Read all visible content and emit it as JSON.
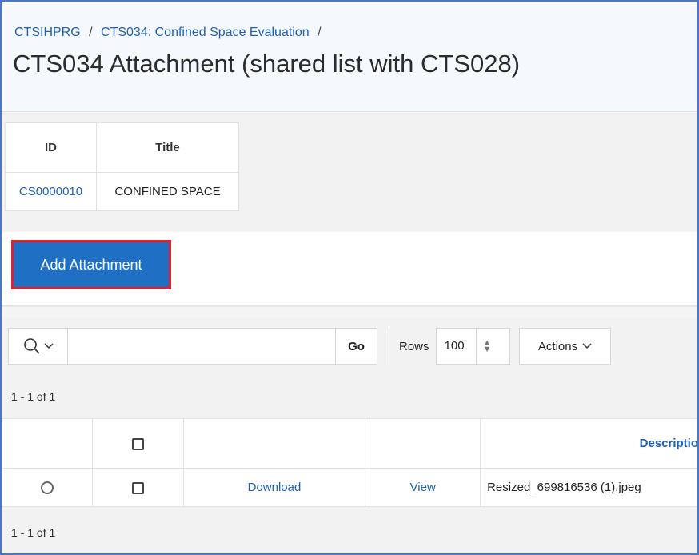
{
  "breadcrumb": {
    "items": [
      "CTSIHPRG",
      "CTS034: Confined Space Evaluation"
    ],
    "separator": "/"
  },
  "page": {
    "title": "CTS034 Attachment (shared list with CTS028)"
  },
  "summary": {
    "headers": {
      "id": "ID",
      "title": "Title"
    },
    "row": {
      "id": "CS0000010",
      "title": "CONFINED SPACE"
    }
  },
  "add_button": {
    "label": "Add Attachment"
  },
  "toolbar": {
    "search_placeholder": "",
    "go_label": "Go",
    "rows_label": "Rows",
    "rows_value": "100",
    "actions_label": "Actions",
    "icons": {
      "search": "search-icon",
      "dropdown": "chevron-down-icon"
    }
  },
  "pagination": {
    "top": "1 - 1 of 1",
    "bottom": "1 - 1 of 1"
  },
  "report": {
    "headers": {
      "description": "Descriptio"
    },
    "rows": [
      {
        "download": "Download",
        "view": "View",
        "description": "Resized_699816536 (1).jpeg"
      }
    ]
  },
  "colors": {
    "accent": "#1f6fc5",
    "highlight_border": "#e0212b",
    "link": "#1f5fb4"
  }
}
